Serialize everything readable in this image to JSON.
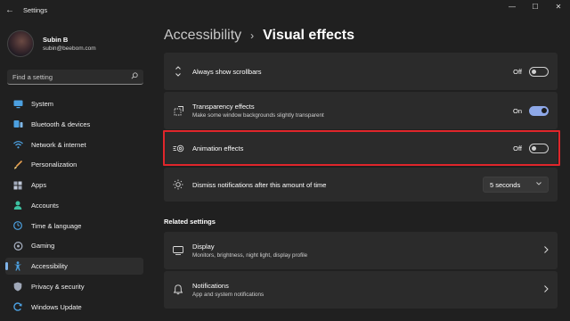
{
  "window": {
    "title": "Settings",
    "back_glyph": "←",
    "controls": {
      "minimize": "—",
      "maximize": "☐",
      "close": "✕"
    }
  },
  "user": {
    "name": "Subin B",
    "email": "subin@beebom.com"
  },
  "search": {
    "placeholder": "Find a setting",
    "icon": "search-icon"
  },
  "sidebar": {
    "items": [
      {
        "label": "System",
        "icon": "monitor-icon",
        "color": "#4ca0e0"
      },
      {
        "label": "Bluetooth & devices",
        "icon": "bluetooth-icon",
        "color": "#4ca0e0"
      },
      {
        "label": "Network & internet",
        "icon": "wifi-icon",
        "color": "#4ca0e0"
      },
      {
        "label": "Personalization",
        "icon": "brush-icon",
        "color": "#e8a050"
      },
      {
        "label": "Apps",
        "icon": "apps-icon",
        "color": "#a0a8b8"
      },
      {
        "label": "Accounts",
        "icon": "person-icon",
        "color": "#3cc0a0"
      },
      {
        "label": "Time & language",
        "icon": "globe-clock-icon",
        "color": "#4ca0e0"
      },
      {
        "label": "Gaming",
        "icon": "gamepad-icon",
        "color": "#a0a8b8"
      },
      {
        "label": "Accessibility",
        "icon": "accessibility-icon",
        "color": "#4ca0e0",
        "active": true
      },
      {
        "label": "Privacy & security",
        "icon": "shield-icon",
        "color": "#a0a8b8"
      },
      {
        "label": "Windows Update",
        "icon": "update-icon",
        "color": "#4ca0e0"
      }
    ]
  },
  "breadcrumb": {
    "parent": "Accessibility",
    "separator": "›",
    "current": "Visual effects"
  },
  "settings": {
    "scrollbars": {
      "title": "Always show scrollbars",
      "state": "Off",
      "icon": "scrollbar-icon"
    },
    "transparency": {
      "title": "Transparency effects",
      "subtitle": "Make some window backgrounds slightly transparent",
      "state": "On",
      "icon": "transparency-icon"
    },
    "animation": {
      "title": "Animation effects",
      "state": "Off",
      "icon": "animation-icon"
    },
    "notifications_timeout": {
      "title": "Dismiss notifications after this amount of time",
      "value": "5 seconds",
      "icon": "sun-icon"
    }
  },
  "related": {
    "heading": "Related settings",
    "items": [
      {
        "title": "Display",
        "subtitle": "Monitors, brightness, night light, display profile",
        "icon": "display-icon"
      },
      {
        "title": "Notifications",
        "subtitle": "App and system notifications",
        "icon": "bell-icon"
      }
    ]
  },
  "colors": {
    "accent": "#8ea8e8",
    "highlight_border": "#e0262b",
    "background": "#202020",
    "card": "#2b2b2b"
  }
}
